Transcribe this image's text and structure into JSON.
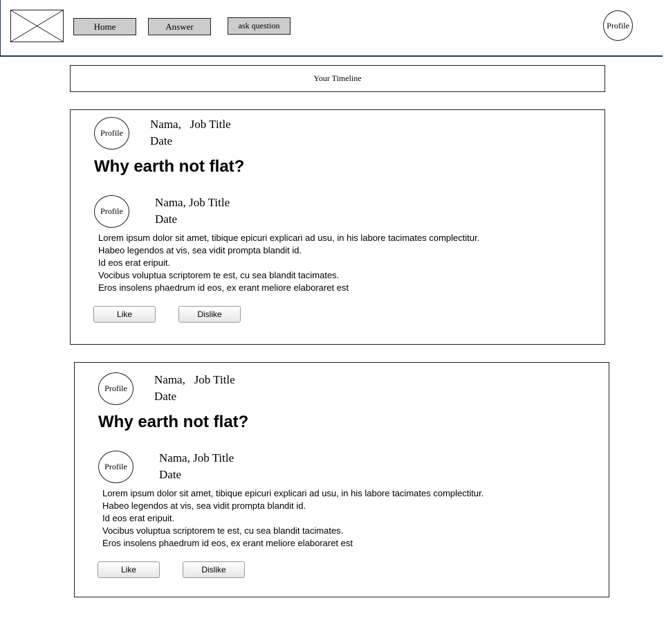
{
  "header": {
    "home_label": "Home",
    "answer_label": "Answer",
    "ask_label": "ask question",
    "profile_label": "Profile"
  },
  "timeline": {
    "label": "Your Timeline"
  },
  "posts": [
    {
      "author_profile": "Profile",
      "author_name": "Nama,",
      "author_job": "Job Title",
      "author_date": "Date",
      "question": "Why earth not flat?",
      "answer": {
        "profile": "Profile",
        "name_job": "Nama, Job Title",
        "date": "Date",
        "lines": [
          "Lorem ipsum dolor sit amet, tibique epicuri explicari ad usu, in his labore tacimates complectitur.",
          "Habeo legendos at vis, sea vidit prompta blandit id.",
          "Id eos erat eripuit.",
          "Vocibus voluptua scriptorem te est, cu sea blandit tacimates.",
          "Eros insolens phaedrum id eos, ex erant meliore elaboraret est"
        ],
        "like_label": "Like",
        "dislike_label": "Dislike"
      }
    },
    {
      "author_profile": "Profile",
      "author_name": "Nama,",
      "author_job": "Job Title",
      "author_date": "Date",
      "question": "Why earth not flat?",
      "answer": {
        "profile": "Profile",
        "name_job": "Nama, Job Title",
        "date": "Date",
        "lines": [
          "Lorem ipsum dolor sit amet, tibique epicuri explicari ad usu, in his labore tacimates complectitur.",
          "Habeo legendos at vis, sea vidit prompta blandit id.",
          "Id eos erat eripuit.",
          "Vocibus voluptua scriptorem te est, cu sea blandit tacimates.",
          "Eros insolens phaedrum id eos, ex erant meliore elaboraret est"
        ],
        "like_label": "Like",
        "dislike_label": "Dislike"
      }
    }
  ]
}
